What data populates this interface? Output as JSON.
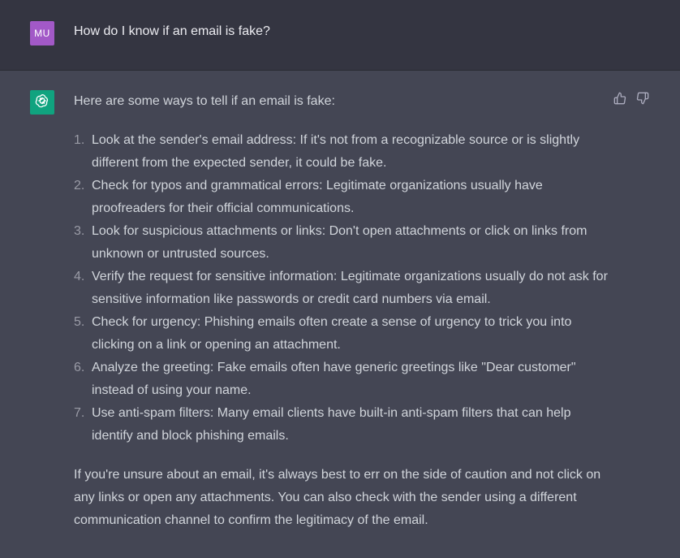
{
  "user_message": {
    "avatar_initials": "MU",
    "avatar_color": "#a259c7",
    "text": "How do I know if an email is fake?"
  },
  "assistant_message": {
    "avatar_icon": "openai-logo-icon",
    "avatar_color": "#10a37f",
    "intro": "Here are some ways to tell if an email is fake:",
    "points": [
      {
        "number": "1.",
        "text": "Look at the sender's email address: If it's not from a recognizable source or is slightly different from the expected sender, it could be fake."
      },
      {
        "number": "2.",
        "text": "Check for typos and grammatical errors: Legitimate organizations usually have proofreaders for their official communications."
      },
      {
        "number": "3.",
        "text": "Look for suspicious attachments or links: Don't open attachments or click on links from unknown or untrusted sources."
      },
      {
        "number": "4.",
        "text": "Verify the request for sensitive information: Legitimate organizations usually do not ask for sensitive information like passwords or credit card numbers via email."
      },
      {
        "number": "5.",
        "text": "Check for urgency: Phishing emails often create a sense of urgency to trick you into clicking on a link or opening an attachment."
      },
      {
        "number": "6.",
        "text": "Analyze the greeting: Fake emails often have generic greetings like \"Dear customer\" instead of using your name."
      },
      {
        "number": "7.",
        "text": "Use anti-spam filters: Many email clients have built-in anti-spam filters that can help identify and block phishing emails."
      }
    ],
    "closing": "If you're unsure about an email, it's always best to err on the side of caution and not click on any links or open any attachments. You can also check with the sender using a different communication channel to confirm the legitimacy of the email."
  },
  "feedback": {
    "thumbs_up_icon": "thumbs-up-icon",
    "thumbs_down_icon": "thumbs-down-icon"
  }
}
